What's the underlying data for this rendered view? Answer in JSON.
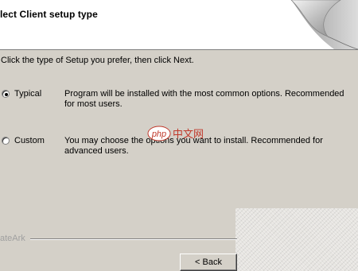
{
  "header": {
    "title": "lect Client setup type"
  },
  "instruction": "Click the type of Setup you prefer, then click Next.",
  "options": [
    {
      "label": "Typical",
      "selected": true,
      "description": "Program will be installed with the most common options.  Recommended for most users."
    },
    {
      "label": "Custom",
      "selected": false,
      "description": "You may choose the options you want to install. Recommended for advanced users."
    }
  ],
  "footer": {
    "brand": "ateArk",
    "back_label": "< Back"
  },
  "watermark": {
    "text_php": "php",
    "text_cn": "中文网"
  },
  "colors": {
    "window_bg": "#d4d0c8",
    "header_bg": "#ffffff",
    "watermark_red": "#c0392b"
  }
}
